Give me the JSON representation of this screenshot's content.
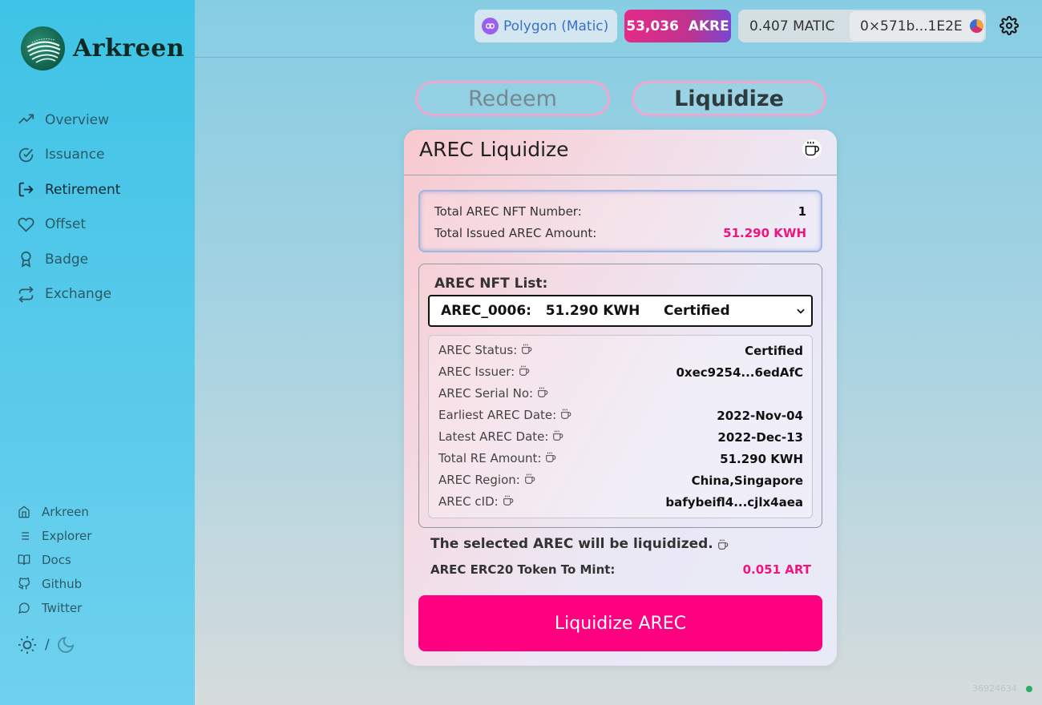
{
  "app": {
    "logo_text": "Arkreen"
  },
  "sidebar": {
    "nav": [
      {
        "label": "Overview",
        "icon": "trending-up-icon"
      },
      {
        "label": "Issuance",
        "icon": "check-circle-icon"
      },
      {
        "label": "Retirement",
        "icon": "log-out-icon",
        "active": true
      },
      {
        "label": "Offset",
        "icon": "heart-icon"
      },
      {
        "label": "Badge",
        "icon": "award-icon"
      },
      {
        "label": "Exchange",
        "icon": "repeat-icon"
      }
    ],
    "links": [
      {
        "label": "Arkreen",
        "icon": "home-icon"
      },
      {
        "label": "Explorer",
        "icon": "list-icon"
      },
      {
        "label": "Docs",
        "icon": "book-icon"
      },
      {
        "label": "Github",
        "icon": "github-icon"
      },
      {
        "label": "Twitter",
        "icon": "message-circle-icon"
      }
    ],
    "theme_separator": "/"
  },
  "header": {
    "network": "Polygon (Matic)",
    "akre_balance": "53,036  AKRE",
    "matic_balance": "0.407 MATIC",
    "address": "0×571b...1E2E"
  },
  "tabs": {
    "redeem": "Redeem",
    "liquidize": "Liquidize"
  },
  "card": {
    "title": "AREC Liquidize",
    "summary": {
      "nft_number_label": "Total AREC NFT Number:",
      "nft_number_value": "1",
      "issued_amount_label": "Total Issued AREC Amount:",
      "issued_amount_value": "51.290 KWH"
    },
    "nft_list_label": "AREC NFT List:",
    "selected_option": "AREC_0006:   51.290 KWH     Certified",
    "details": [
      {
        "label": "AREC Status:",
        "value": "Certified"
      },
      {
        "label": "AREC Issuer:",
        "value": "0xec9254...6edAfC"
      },
      {
        "label": "AREC Serial No:",
        "value": ""
      },
      {
        "label": "Earliest AREC Date:",
        "value": "2022-Nov-04"
      },
      {
        "label": "Latest AREC Date:",
        "value": "2022-Dec-13"
      },
      {
        "label": "Total RE Amount:",
        "value": "51.290 KWH"
      },
      {
        "label": "AREC Region:",
        "value": "China,Singapore"
      },
      {
        "label": "AREC cID:",
        "value": "bafybeifl4...cjlx4aea"
      }
    ],
    "note": "The selected AREC will be liquidized.",
    "mint_label": "AREC ERC20 Token To Mint:",
    "mint_value": "0.051 ART",
    "cta": "Liquidize AREC"
  },
  "footer": {
    "block_number": "36924634"
  },
  "colors": {
    "accent": "#ff0080",
    "amount": "#f0157d",
    "status_dot": "#27ae60"
  }
}
